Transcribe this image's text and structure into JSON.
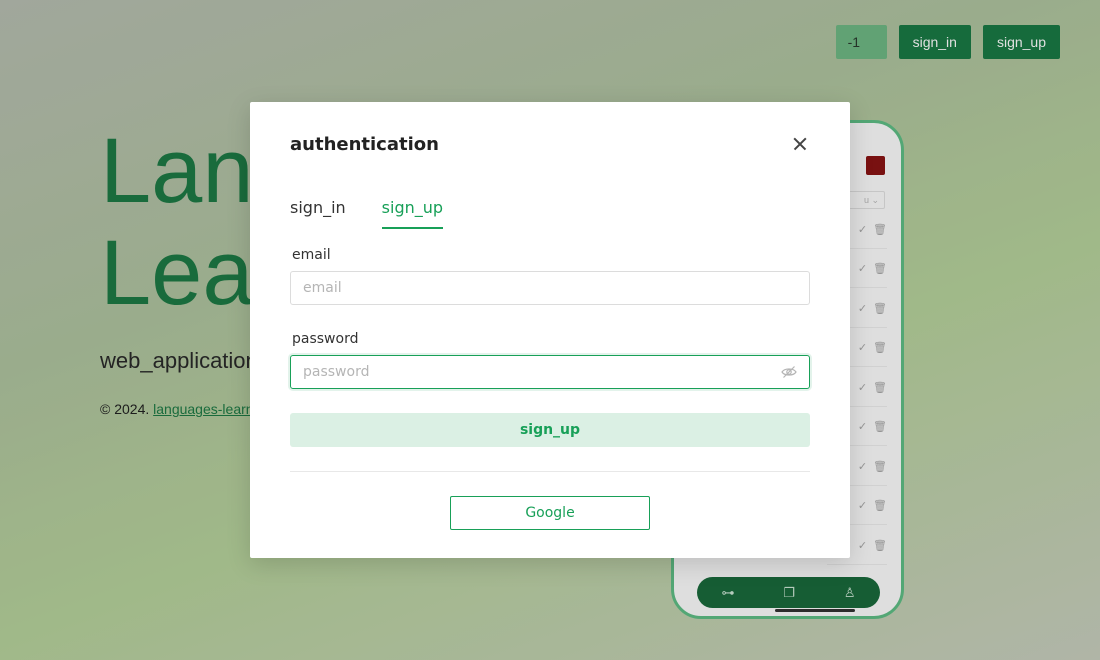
{
  "topbar": {
    "language_value": "-1",
    "sign_in_label": "sign_in",
    "sign_up_label": "sign_up"
  },
  "hero": {
    "title_line1": "Lan",
    "title_line2": "Lea",
    "subtitle": "web_application",
    "footer_prefix": "© 2024.",
    "footer_link": "languages-learn"
  },
  "phone": {
    "select_text": "u"
  },
  "modal": {
    "title": "authentication",
    "tabs": [
      {
        "label": "sign_in",
        "active": false
      },
      {
        "label": "sign_up",
        "active": true
      }
    ],
    "email": {
      "label": "email",
      "value": "",
      "placeholder": "email"
    },
    "password": {
      "label": "password",
      "value": "",
      "placeholder": "password"
    },
    "submit_label": "sign_up",
    "google_label": "Google"
  },
  "colors": {
    "accent": "#18a058",
    "brand_dark": "#1a7a45",
    "submit_bg": "#dbf0e4"
  },
  "icons": [
    "close-icon",
    "eye-off-icon",
    "dumbbell-icon",
    "book-icon",
    "user-icon",
    "check-icon",
    "trash-icon",
    "chevron-down-icon"
  ]
}
